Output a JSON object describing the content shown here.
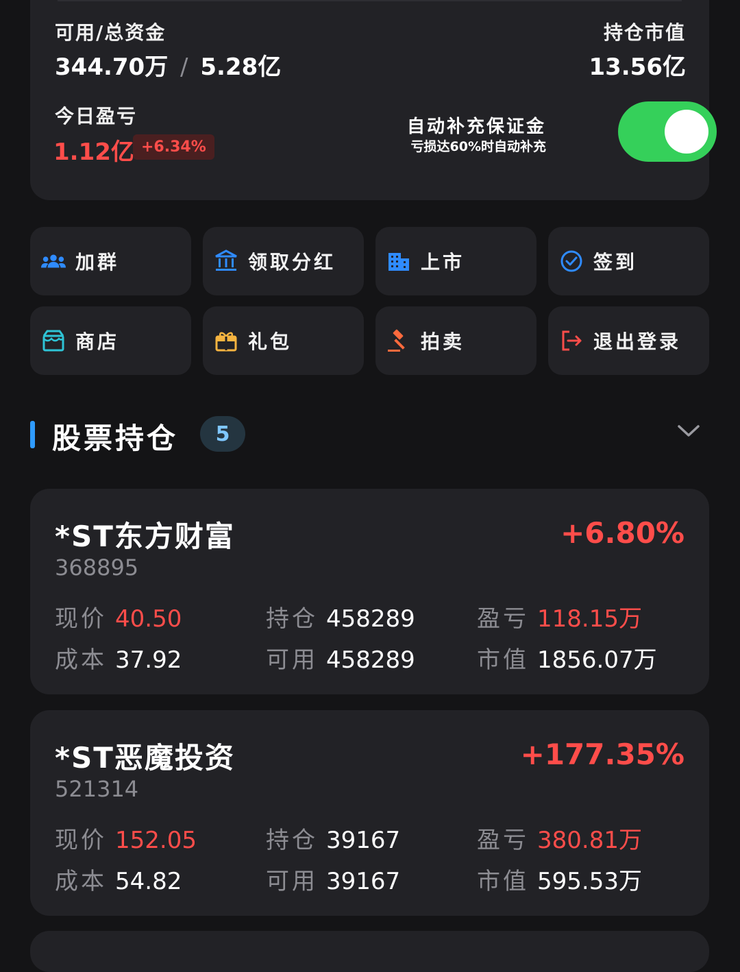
{
  "summary": {
    "available_total_label": "可用/总资金",
    "available": "344.70万",
    "separator": "/",
    "total": "5.28亿",
    "position_value_label": "持仓市值",
    "position_value": "13.56亿",
    "today_pnl_label": "今日盈亏",
    "today_pnl": "1.12亿",
    "today_pnl_pct": "+6.34%",
    "auto_margin_title": "自动补充保证金",
    "auto_margin_sub": "亏损达60%时自动补充",
    "auto_margin_on": true
  },
  "actions": [
    {
      "label": "加群",
      "icon": "group-icon",
      "color": "#2f8bff"
    },
    {
      "label": "领取分红",
      "icon": "bank-icon",
      "color": "#2f8bff"
    },
    {
      "label": "上市",
      "icon": "building-icon",
      "color": "#2f8bff"
    },
    {
      "label": "签到",
      "icon": "check-circle-icon",
      "color": "#2f8bff"
    },
    {
      "label": "商店",
      "icon": "shop-icon",
      "color": "#2ec4d6"
    },
    {
      "label": "礼包",
      "icon": "gift-icon",
      "color": "#f5b440"
    },
    {
      "label": "拍卖",
      "icon": "gavel-icon",
      "color": "#ff6a3d"
    },
    {
      "label": "退出登录",
      "icon": "logout-icon",
      "color": "#ff4d4a"
    }
  ],
  "holdings_section": {
    "title": "股票持仓",
    "count": "5"
  },
  "stocks": [
    {
      "name": "*ST东方财富",
      "code": "368895",
      "change_pct": "+6.80%",
      "price_label": "现价",
      "price": "40.50",
      "cost_label": "成本",
      "cost": "37.92",
      "hold_label": "持仓",
      "hold": "458289",
      "avail_label": "可用",
      "avail": "458289",
      "pnl_label": "盈亏",
      "pnl": "118.15万",
      "mv_label": "市值",
      "mv": "1856.07万"
    },
    {
      "name": "*ST恶魔投资",
      "code": "521314",
      "change_pct": "+177.35%",
      "price_label": "现价",
      "price": "152.05",
      "cost_label": "成本",
      "cost": "54.82",
      "hold_label": "持仓",
      "hold": "39167",
      "avail_label": "可用",
      "avail": "39167",
      "pnl_label": "盈亏",
      "pnl": "380.81万",
      "mv_label": "市值",
      "mv": "595.53万"
    }
  ]
}
